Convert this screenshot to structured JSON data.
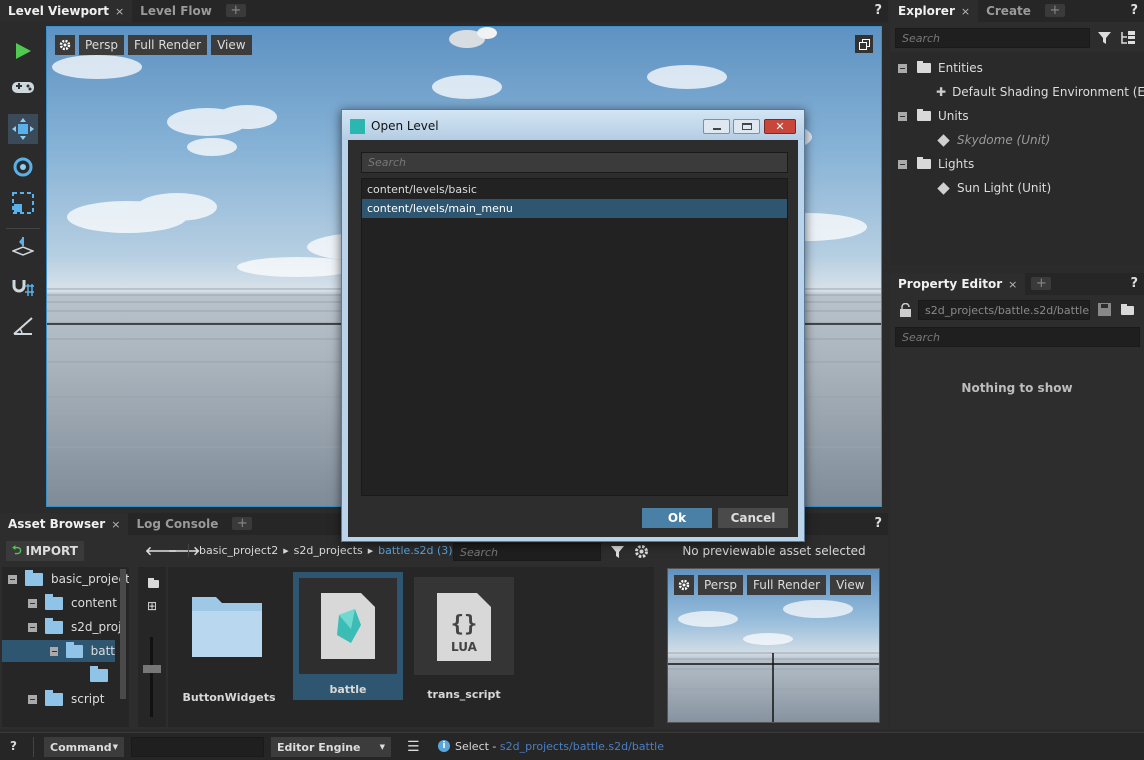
{
  "viewport": {
    "tabs": [
      {
        "label": "Level Viewport",
        "close": "×"
      },
      {
        "label": "Level Flow"
      }
    ],
    "help": "?",
    "toolbar": {
      "persp": "Persp",
      "full_render": "Full Render",
      "view": "View"
    }
  },
  "explorer": {
    "tabs": [
      {
        "label": "Explorer",
        "close": "×"
      },
      {
        "label": "Create"
      }
    ],
    "help": "?",
    "search_placeholder": "Search",
    "tree": [
      {
        "label": "Entities"
      },
      {
        "label": "Default Shading Environment (Entity)"
      },
      {
        "label": "Units"
      },
      {
        "label": "Skydome (Unit)"
      },
      {
        "label": "Lights"
      },
      {
        "label": "Sun Light (Unit)"
      }
    ]
  },
  "property_editor": {
    "tab": "Property Editor",
    "close": "×",
    "help": "?",
    "path": "s2d_projects/battle.s2d/battle",
    "search_placeholder": "Search",
    "empty": "Nothing to show"
  },
  "asset_browser": {
    "tabs": [
      {
        "label": "Asset Browser",
        "close": "×"
      },
      {
        "label": "Log Console"
      }
    ],
    "help": "?",
    "import": "IMPORT",
    "breadcrumb": [
      "basic_project2",
      "s2d_projects",
      "battle.s2d (3)"
    ],
    "search_placeholder": "Search",
    "tree": [
      "basic_project",
      "content",
      "s2d_proj",
      "batt",
      "script"
    ],
    "items": [
      {
        "label": "ButtonWidgets"
      },
      {
        "label": "battle"
      },
      {
        "label": "trans_script",
        "badge": "LUA"
      }
    ],
    "preview_label": "No previewable asset selected",
    "preview_toolbar": {
      "persp": "Persp",
      "full_render": "Full Render",
      "view": "View"
    }
  },
  "statusbar": {
    "help": "?",
    "command": "Command",
    "engine": "Editor Engine",
    "select_label": "Select - ",
    "select_path": "s2d_projects/battle.s2d/battle"
  },
  "dialog": {
    "title": "Open Level",
    "search_placeholder": "Search",
    "items": [
      {
        "label": "content/levels/basic",
        "selected": false
      },
      {
        "label": "content/levels/main_menu",
        "selected": true
      }
    ],
    "ok": "Ok",
    "cancel": "Cancel"
  },
  "colors": {
    "accent": "#4a7fa6",
    "selection": "#2f5670",
    "play": "#4fc94f",
    "link": "#5aa6dc"
  }
}
